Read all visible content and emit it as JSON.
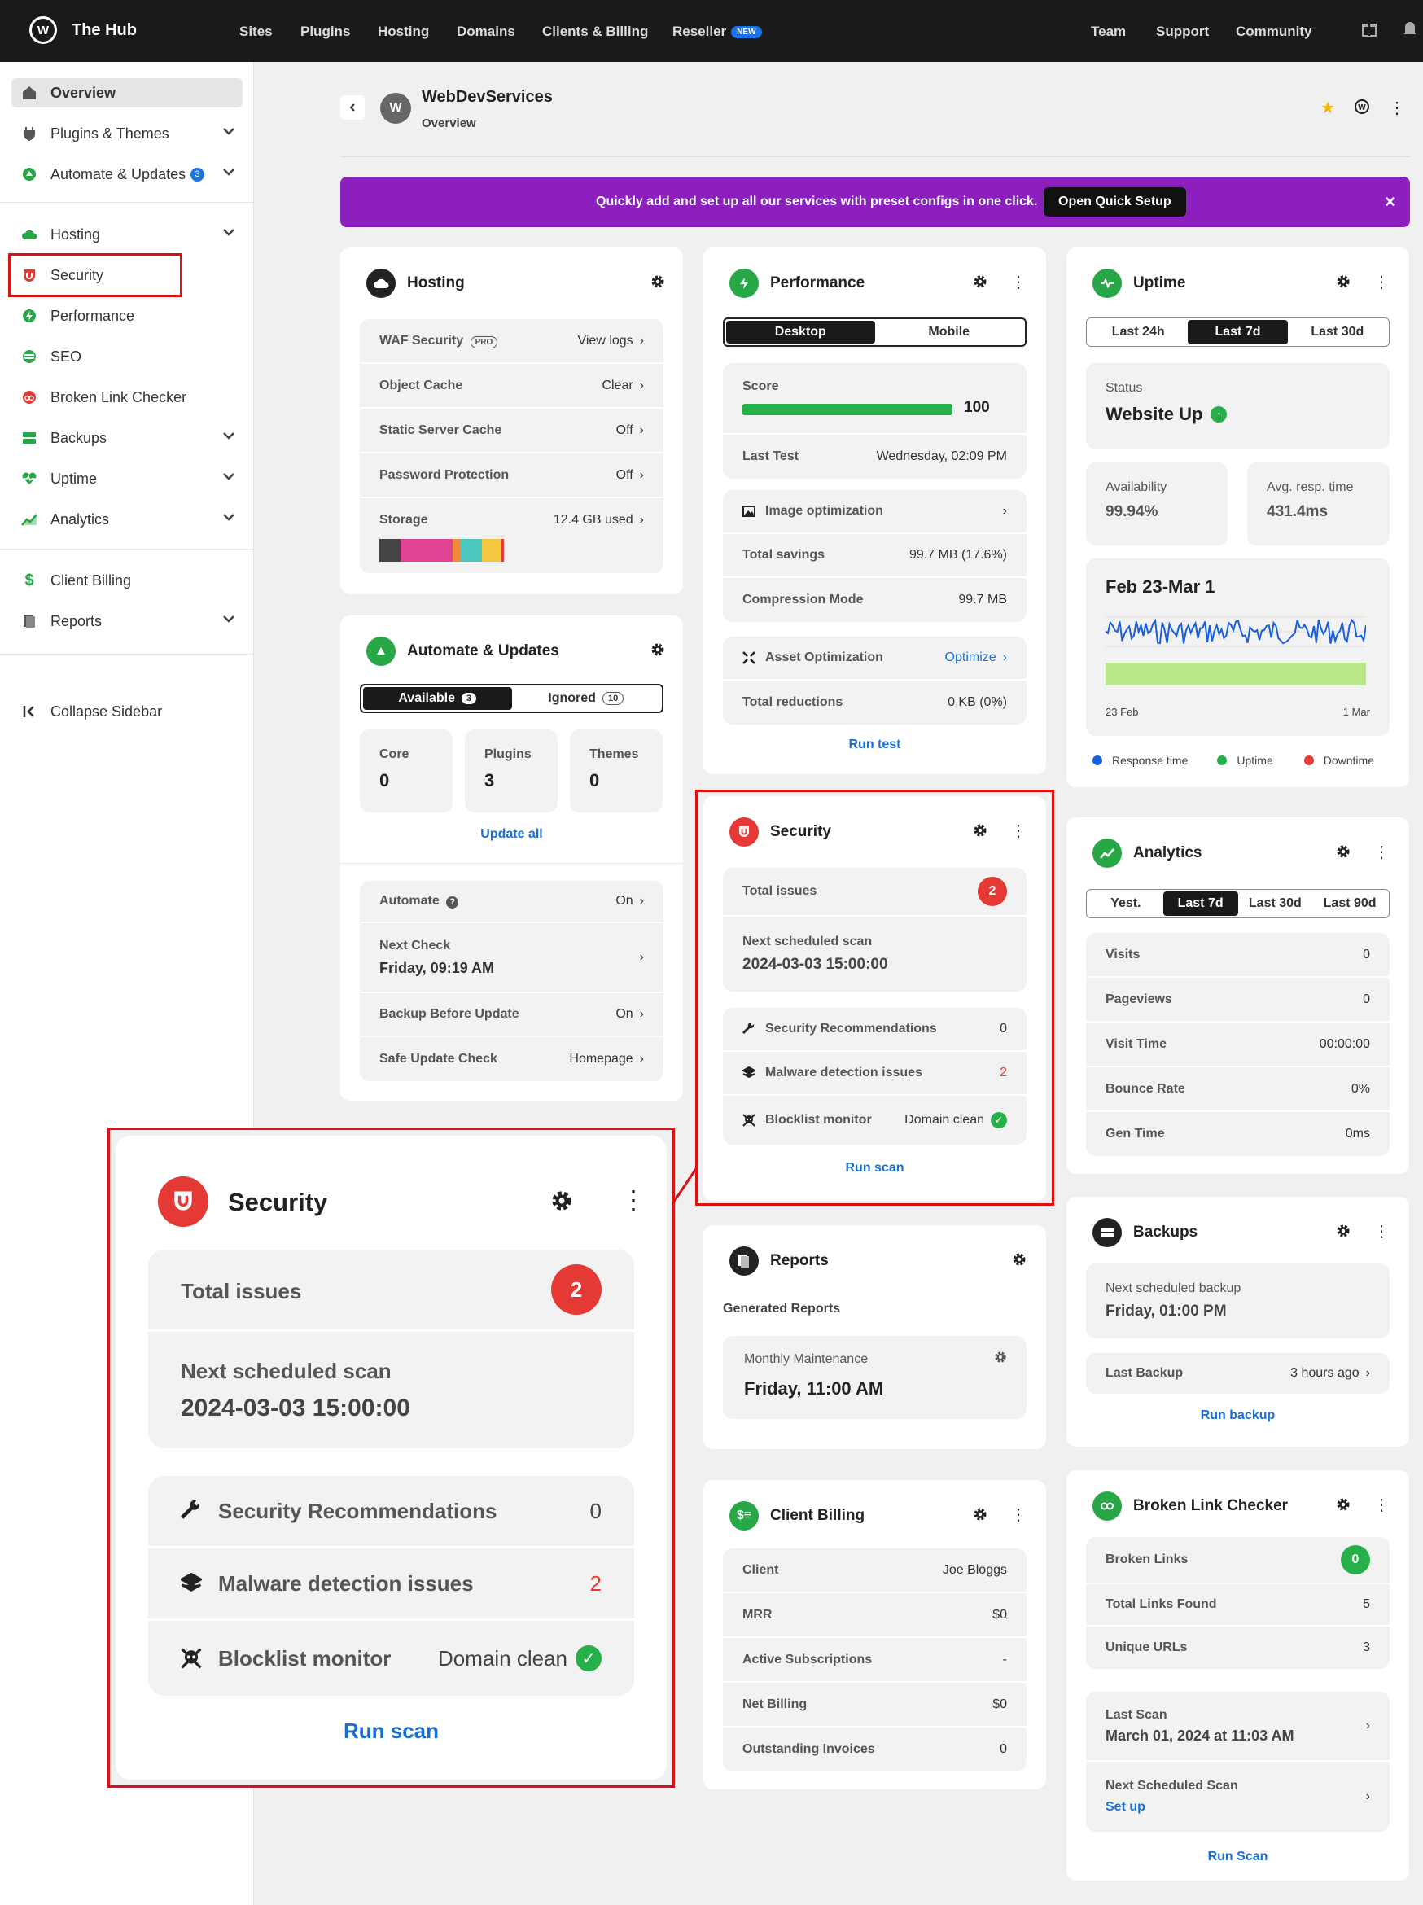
{
  "topbar": {
    "brand": "The Hub",
    "nav": [
      "Sites",
      "Plugins",
      "Hosting",
      "Domains",
      "Clients & Billing",
      "Reseller"
    ],
    "new_badge": "NEW",
    "right_nav": [
      "Team",
      "Support",
      "Community"
    ]
  },
  "sidebar": {
    "items": [
      {
        "label": "Overview"
      },
      {
        "label": "Plugins & Themes"
      },
      {
        "label": "Automate & Updates",
        "count": "3"
      },
      {
        "label": "Hosting"
      },
      {
        "label": "Security"
      },
      {
        "label": "Performance"
      },
      {
        "label": "SEO"
      },
      {
        "label": "Broken Link Checker"
      },
      {
        "label": "Backups"
      },
      {
        "label": "Uptime"
      },
      {
        "label": "Analytics"
      },
      {
        "label": "Client Billing"
      },
      {
        "label": "Reports"
      }
    ],
    "collapse": "Collapse Sidebar"
  },
  "header": {
    "avatar": "W",
    "site": "WebDevServices",
    "sub": "Overview"
  },
  "banner": {
    "text": "Quickly add and set up all our services with preset configs in one click.",
    "button": "Open Quick Setup",
    "close": "×"
  },
  "hosting": {
    "title": "Hosting",
    "rows": [
      {
        "l": "WAF Security",
        "badge": "PRO",
        "r": "View logs"
      },
      {
        "l": "Object Cache",
        "r": "Clear"
      },
      {
        "l": "Static Server Cache",
        "r": "Off"
      },
      {
        "l": "Password Protection",
        "r": "Off"
      },
      {
        "l": "Storage",
        "r": "12.4 GB used"
      }
    ]
  },
  "automate": {
    "title": "Automate & Updates",
    "tabs": [
      "Available",
      "Ignored"
    ],
    "tab_counts": [
      "3",
      "10"
    ],
    "stats": [
      {
        "t": "Core",
        "v": "0"
      },
      {
        "t": "Plugins",
        "v": "3"
      },
      {
        "t": "Themes",
        "v": "0"
      }
    ],
    "update_all": "Update all",
    "rows": [
      {
        "l": "Automate",
        "r": "On"
      },
      {
        "l": "Next Check",
        "v": "Friday, 09:19 AM"
      },
      {
        "l": "Backup Before Update",
        "r": "On"
      },
      {
        "l": "Safe Update Check",
        "r": "Homepage"
      }
    ]
  },
  "performance": {
    "title": "Performance",
    "tabs": [
      "Desktop",
      "Mobile"
    ],
    "score_label": "Score",
    "score": "100",
    "score_fraction": 1.0,
    "last_test_label": "Last Test",
    "last_test": "Wednesday, 02:09 PM",
    "image_opt": "Image optimization",
    "total_savings_label": "Total savings",
    "total_savings": "99.7 MB (17.6%)",
    "compression_label": "Compression Mode",
    "compression": "99.7 MB",
    "asset_opt": "Asset Optimization",
    "optimize": "Optimize",
    "reductions_label": "Total reductions",
    "reductions": "0 KB (0%)",
    "run": "Run test"
  },
  "security": {
    "title": "Security",
    "total_label": "Total issues",
    "total": "2",
    "next_label": "Next scheduled scan",
    "next": "2024-03-03 15:00:00",
    "rows": [
      {
        "l": "Security Recommendations",
        "r": "0"
      },
      {
        "l": "Malware detection issues",
        "r": "2"
      },
      {
        "l": "Blocklist monitor",
        "r": "Domain clean"
      }
    ],
    "run": "Run scan"
  },
  "reports": {
    "title": "Reports",
    "sub": "Generated Reports",
    "item_label": "Monthly Maintenance",
    "item_value": "Friday, 11:00 AM"
  },
  "billing": {
    "title": "Client Billing",
    "rows": [
      {
        "l": "Client",
        "r": "Joe Bloggs"
      },
      {
        "l": "MRR",
        "r": "$0"
      },
      {
        "l": "Active Subscriptions",
        "r": "-"
      },
      {
        "l": "Net Billing",
        "r": "$0"
      },
      {
        "l": "Outstanding Invoices",
        "r": "0"
      }
    ]
  },
  "uptime": {
    "title": "Uptime",
    "tabs": [
      "Last 24h",
      "Last 7d",
      "Last 30d"
    ],
    "status_label": "Status",
    "status": "Website Up",
    "avail_label": "Availability",
    "avail": "99.94%",
    "resp_label": "Avg. resp. time",
    "resp": "431.4ms",
    "range": "Feb 23-Mar 1",
    "x_start": "23 Feb",
    "x_end": "1 Mar",
    "legend": [
      "Response time",
      "Uptime",
      "Downtime"
    ],
    "legend_colors": [
      "#1a5fe0",
      "#27b04a",
      "#e53935"
    ]
  },
  "analytics": {
    "title": "Analytics",
    "tabs": [
      "Yest.",
      "Last 7d",
      "Last 30d",
      "Last 90d"
    ],
    "rows": [
      {
        "l": "Visits",
        "r": "0"
      },
      {
        "l": "Pageviews",
        "r": "0"
      },
      {
        "l": "Visit Time",
        "r": "00:00:00"
      },
      {
        "l": "Bounce Rate",
        "r": "0%"
      },
      {
        "l": "Gen Time",
        "r": "0ms"
      }
    ]
  },
  "backups": {
    "title": "Backups",
    "next_label": "Next scheduled backup",
    "next": "Friday, 01:00 PM",
    "last_label": "Last Backup",
    "last": "3 hours ago",
    "run": "Run backup"
  },
  "blc": {
    "title": "Broken Link Checker",
    "rows": [
      {
        "l": "Broken Links",
        "r": "0"
      },
      {
        "l": "Total Links Found",
        "r": "5"
      },
      {
        "l": "Unique URLs",
        "r": "3"
      }
    ],
    "last_label": "Last Scan",
    "last": "March 01, 2024 at 11:03 AM",
    "next_label": "Next Scheduled Scan",
    "next": "Set up",
    "run": "Run Scan"
  },
  "colors": {
    "accent": "#1a6fd6",
    "banner": "#8d1fbf",
    "green": "#27a745",
    "red": "#e53935"
  }
}
